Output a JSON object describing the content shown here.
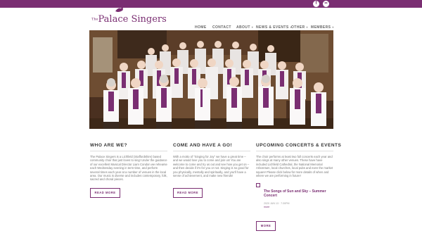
{
  "social": {
    "facebook": "f",
    "flickr": "••"
  },
  "logo": {
    "prefix": "The",
    "name": "Palace Singers"
  },
  "nav": [
    {
      "label": "HOME",
      "dropdown": false
    },
    {
      "label": "CONTACT",
      "dropdown": false
    },
    {
      "label": "ABOUT",
      "dropdown": true
    },
    {
      "label": "NEWS & EVENTS",
      "dropdown": true
    },
    {
      "label": "OTHER",
      "dropdown": true
    },
    {
      "label": "MEMBERS",
      "dropdown": true
    }
  ],
  "hero": {
    "kind": "choir group photograph in church"
  },
  "sections": {
    "who": {
      "title": "WHO ARE WE?",
      "body": "The Palace Singers is a Lichfield (Staffordshire) based community choir that just loves to sing! Under the guidance of our excellent Musical Director Liam Condon we rehearse each Wednesday evening in term-time, and perform several times each year at a number of venues in the local area. Our music is diverse and includes contemporary, folk, sacred and choral pieces.",
      "button": "READ MORE"
    },
    "come": {
      "title": "COME AND HAVE A GO!",
      "body": "With a motto of \"Singing for Joy\" we have a great time – and we would love you to come and join us! You are welcome to come and try us out and see how you get on – and then decide if it's for you or not. Singing is so good for you physically, mentally and spiritually, and you'll have a sense of achievement, and make new friends!",
      "button": "READ MORE"
    },
    "upcoming": {
      "title": "UPCOMING CONCERTS & EVENTS",
      "body": "The choir performs at least two full concerts each year and also sings at many other venues. These have have included Lichfield Cathedral, the National Memorial Arboretum, local churches, local pubs and even the market square! Please click below for more details of when and where we are performing in future!",
      "event": {
        "title": "The Songs of Sun and Sky – Summer Concert",
        "date": "2020 JUN 13 · 7:30PM",
        "link": "more"
      },
      "button": "MORE"
    }
  },
  "colors": {
    "brand": "#7a2e72",
    "text": "#555555"
  }
}
